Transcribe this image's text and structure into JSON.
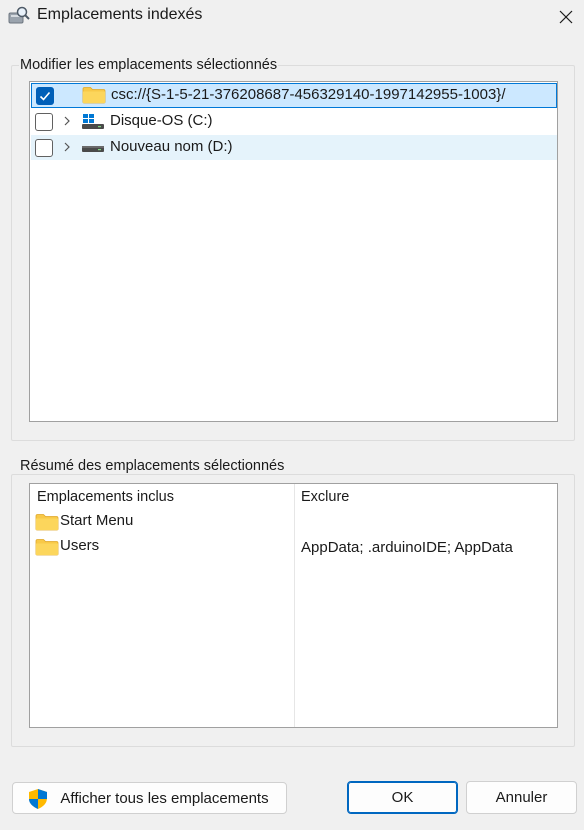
{
  "window": {
    "title": "Emplacements indexés",
    "close_icon": "close-icon",
    "app_icon": "search-index-icon"
  },
  "modify_group": {
    "label": "Modifier les emplacements sélectionnés",
    "items": [
      {
        "label": "csc://{S-1-5-21-376208687-456329140-1997142955-1003}/",
        "checked": true,
        "expandable": false,
        "icon": "folder-icon",
        "selected": true
      },
      {
        "label": "Disque-OS (C:)",
        "checked": false,
        "expandable": true,
        "icon": "windows-drive-icon"
      },
      {
        "label": "Nouveau nom (D:)",
        "checked": false,
        "expandable": true,
        "icon": "drive-icon",
        "hover": true
      }
    ]
  },
  "summary_group": {
    "label": "Résumé des emplacements sélectionnés",
    "columns": {
      "included": "Emplacements inclus",
      "exclude": "Exclure"
    },
    "rows": [
      {
        "included": "Start Menu",
        "exclude": "",
        "icon": "folder-icon"
      },
      {
        "included": "Users",
        "exclude": "AppData; .arduinoIDE; AppData",
        "icon": "folder-icon"
      }
    ]
  },
  "buttons": {
    "show_all": "Afficher tous les emplacements",
    "ok": "OK",
    "cancel": "Annuler"
  },
  "colors": {
    "accent": "#005fb8",
    "selection": "#cce8ff",
    "folder": "#f8c948"
  }
}
